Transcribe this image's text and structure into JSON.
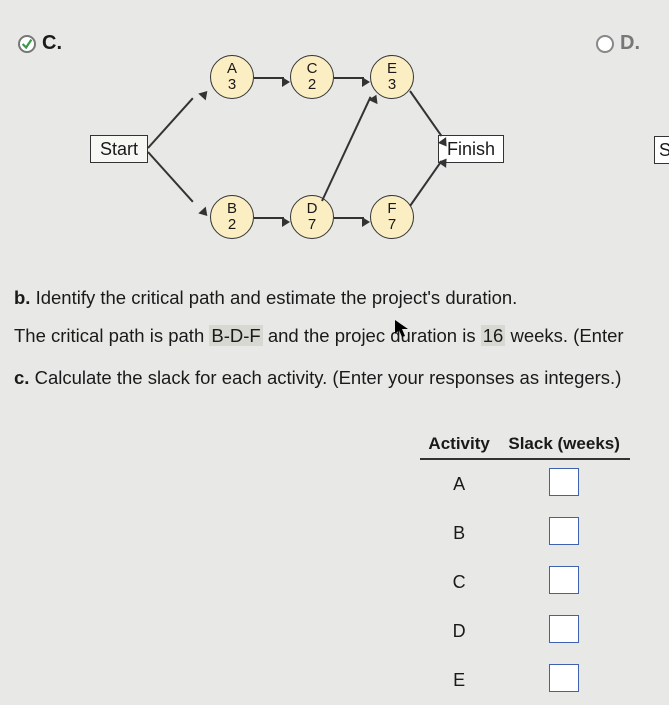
{
  "options": {
    "c": {
      "label": "C.",
      "checked": true
    },
    "d": {
      "label": "D.",
      "checked": false
    }
  },
  "diagram": {
    "start": "Start",
    "finish": "Finish",
    "nodes": {
      "a": {
        "name": "A",
        "dur": "3"
      },
      "b": {
        "name": "B",
        "dur": "2"
      },
      "c": {
        "name": "C",
        "dur": "2"
      },
      "d": {
        "name": "D",
        "dur": "7"
      },
      "e": {
        "name": "E",
        "dur": "3"
      },
      "f": {
        "name": "F",
        "dur": "7"
      }
    },
    "st_partial": "St"
  },
  "question_b_prefix": "b.",
  "question_b_text": "Identify the critical path and estimate the project's duration.",
  "answer_b_pre": "The critical path is path ",
  "answer_b_path": "B-D-F",
  "answer_b_mid": " and the projec  duration is ",
  "answer_b_dur": "16",
  "answer_b_post": " weeks. (Enter",
  "question_c_prefix": "c.",
  "question_c_text": "Calculate the slack for each activity. (Enter your responses as integers.)",
  "table": {
    "h1": "Activity",
    "h2": "Slack (weeks)",
    "rows": [
      "A",
      "B",
      "C",
      "D",
      "E"
    ]
  }
}
